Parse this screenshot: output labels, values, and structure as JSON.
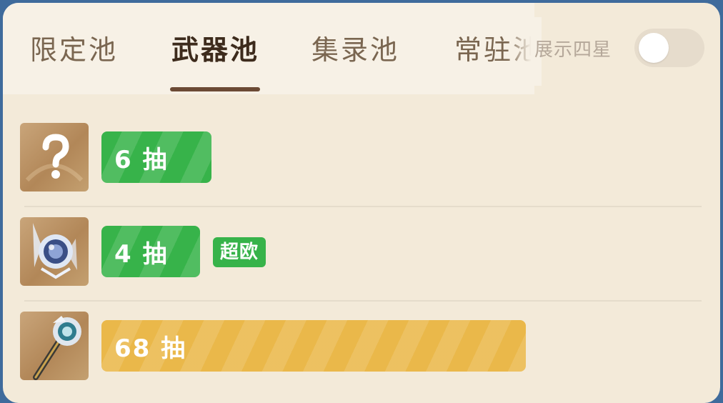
{
  "tabs": [
    {
      "label": "限定池",
      "active": false
    },
    {
      "label": "武器池",
      "active": true
    },
    {
      "label": "集录池",
      "active": false
    },
    {
      "label": "常驻池",
      "active": false
    }
  ],
  "toggle": {
    "label": "展示四星",
    "on": false
  },
  "records": [
    {
      "count_text": "6 抽",
      "pulls": 6,
      "bar_color": "#37b34a",
      "badge": "",
      "item_icon": "question-mark-icon"
    },
    {
      "count_text": "4 抽",
      "pulls": 4,
      "bar_color": "#37b34a",
      "badge": "超欧",
      "item_icon": "weapon-catalyst-icon"
    },
    {
      "count_text": "68 抽",
      "pulls": 68,
      "bar_color": "#eab84a",
      "badge": "",
      "item_icon": "weapon-polearm-icon"
    }
  ]
}
